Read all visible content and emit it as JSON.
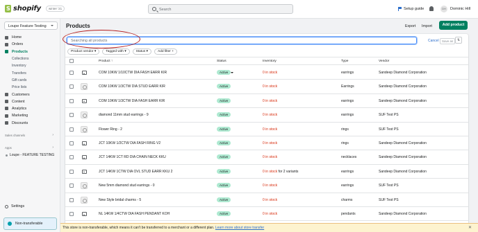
{
  "topbar": {
    "logo_text": "shopify",
    "logo_badge": "winter '21",
    "search_placeholder": "Search",
    "setup_guide": "Setup guide",
    "avatar_initials": "DH",
    "username": "Dominic Hill"
  },
  "sidebar": {
    "store": "Loupe Feature Testing",
    "items": [
      {
        "label": "Home",
        "icon": "home-icon"
      },
      {
        "label": "Orders",
        "icon": "orders-icon"
      },
      {
        "label": "Products",
        "icon": "tag-icon",
        "active": true
      }
    ],
    "product_sub": [
      "Collections",
      "Inventory",
      "Transfers",
      "Gift cards",
      "Price lists"
    ],
    "items2": [
      {
        "label": "Customers",
        "icon": "person-icon"
      },
      {
        "label": "Content",
        "icon": "content-icon"
      },
      {
        "label": "Analytics",
        "icon": "analytics-icon"
      },
      {
        "label": "Marketing",
        "icon": "marketing-icon"
      },
      {
        "label": "Discounts",
        "icon": "discount-icon"
      }
    ],
    "sales_channels": "Sales channels",
    "apps": "Apps",
    "app_item": "Loupe - FEATURE TESTING",
    "settings": "Settings",
    "non_transferable": "Non-transferable"
  },
  "main": {
    "title": "Products",
    "export": "Export",
    "import": "Import",
    "add_product": "Add product",
    "search_placeholder": "Searching all products",
    "cancel": "Cancel",
    "save_as": "Save as",
    "filters": [
      "Product vendor ▾",
      "Tagged with ▾",
      "Status ▾",
      "Add filter +"
    ],
    "columns": {
      "product": "Product ↑",
      "status": "Status",
      "inventory": "Inventory",
      "type": "Type",
      "vendor": "Vendor"
    }
  },
  "rows": [
    {
      "name": "COM 10KW 1/10CTW DIA FASH EARR KIR",
      "status": "Active",
      "inventory": "0 in stock",
      "extra": "",
      "type": "earrings",
      "vendor": "Sandeep Diamond Corporation",
      "thumb": "image-icon",
      "caret": true
    },
    {
      "name": "COM 10KW 1/3CTW DIA STUD EARR KIR",
      "status": "Active",
      "inventory": "0 in stock",
      "extra": "",
      "type": "Earrings",
      "vendor": "Sandeep Diamond Corporation",
      "thumb": "studs-photo"
    },
    {
      "name": "COM 10KW 1/3CTW DIA FASH EARR KIR",
      "status": "Active",
      "inventory": "0 in stock",
      "extra": "",
      "type": "earrings",
      "vendor": "Sandeep Diamond Corporation",
      "thumb": "image-icon"
    },
    {
      "name": "diamond 11mm stud earrings - 9",
      "status": "Active",
      "inventory": "0 in stock",
      "extra": "",
      "type": "earrings",
      "vendor": "SUF Test PS",
      "thumb": "earring-photo"
    },
    {
      "name": "Flower Ring - 2",
      "status": "Active",
      "inventory": "0 in stock",
      "extra": "",
      "type": "rings",
      "vendor": "SUF Test PS",
      "thumb": "ring-photo"
    },
    {
      "name": "JCT 10KW 1/2CTW DIA FASH RING V2",
      "status": "Active",
      "inventory": "0 in stock",
      "extra": "",
      "type": "rings",
      "vendor": "Sandeep Diamond Corporation",
      "thumb": "image-icon"
    },
    {
      "name": "JCT 14KW 1CT RD DIA CHAIN NECK KKU",
      "status": "Active",
      "inventory": "0 in stock",
      "extra": "",
      "type": "necklaces",
      "vendor": "Sandeep Diamond Corporation",
      "thumb": "image-icon"
    },
    {
      "name": "JCT 14KW 1CTW DIA OVL STUD EARR KKU 2",
      "status": "Active",
      "inventory": "0 in stock",
      "extra": " for 2 variants",
      "type": "earrings",
      "vendor": "Sandeep Diamond Corporation",
      "thumb": "image-icon"
    },
    {
      "name": "New 5mm diamond stud earrings - 0",
      "status": "Active",
      "inventory": "0 in stock",
      "extra": "",
      "type": "earrings",
      "vendor": "SUF Test PS",
      "thumb": "stud-photo"
    },
    {
      "name": "New Style bridal charms - 5",
      "status": "Active",
      "inventory": "0 in stock",
      "extra": "",
      "type": "charms",
      "vendor": "SUF Test PS",
      "thumb": "charm-photo"
    },
    {
      "name": "NL 14KW 1/4CTW DIA FASH PENDANT KOH",
      "status": "Active",
      "inventory": "0 in stock",
      "extra": "",
      "type": "pendants",
      "vendor": "Sandeep Diamond Corporation",
      "thumb": "image-icon"
    }
  ],
  "notice": {
    "text": "This store is non-transferable, which means it can't be transferred to a merchant or a different plan.",
    "link": "Learn more about store transfer"
  },
  "colors": {
    "brand_green": "#008060",
    "annotation_red": "#b41e1e",
    "out_of_stock_red": "#d72c0d",
    "active_badge": "#aee9d1"
  }
}
